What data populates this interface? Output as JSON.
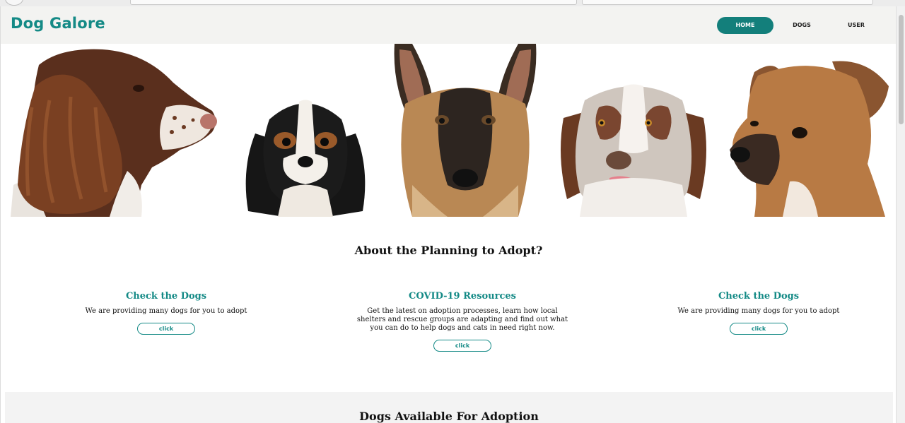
{
  "brand": "Dog Galore",
  "nav": {
    "home": "HOME",
    "dogs": "DOGS",
    "user": "USER"
  },
  "about": {
    "title": "About the Planning to Adopt?",
    "cards": [
      {
        "title": "Check the Dogs",
        "text": "We are providing many dogs for you to adopt",
        "button": "click"
      },
      {
        "title": "COVID-19 Resources",
        "text": "Get the latest on adoption processes, learn how local shelters and rescue groups are adapting and find out what you can do to help dogs and cats in need right now.",
        "button": "click"
      },
      {
        "title": "Check the Dogs",
        "text": "We are providing many dogs for you to adopt",
        "button": "click"
      }
    ]
  },
  "available": {
    "title": "Dogs Available For Adoption"
  },
  "colors": {
    "accent": "#148a86",
    "nav_active": "#137f7b",
    "navbar_bg": "#f3f3f1"
  },
  "hero": {
    "dogs": [
      "springer-spaniel-dog-image",
      "cavalier-king-charles-dog-image",
      "german-shepherd-dog-image",
      "australian-shepherd-dog-image",
      "brown-mixed-breed-dog-image"
    ]
  }
}
